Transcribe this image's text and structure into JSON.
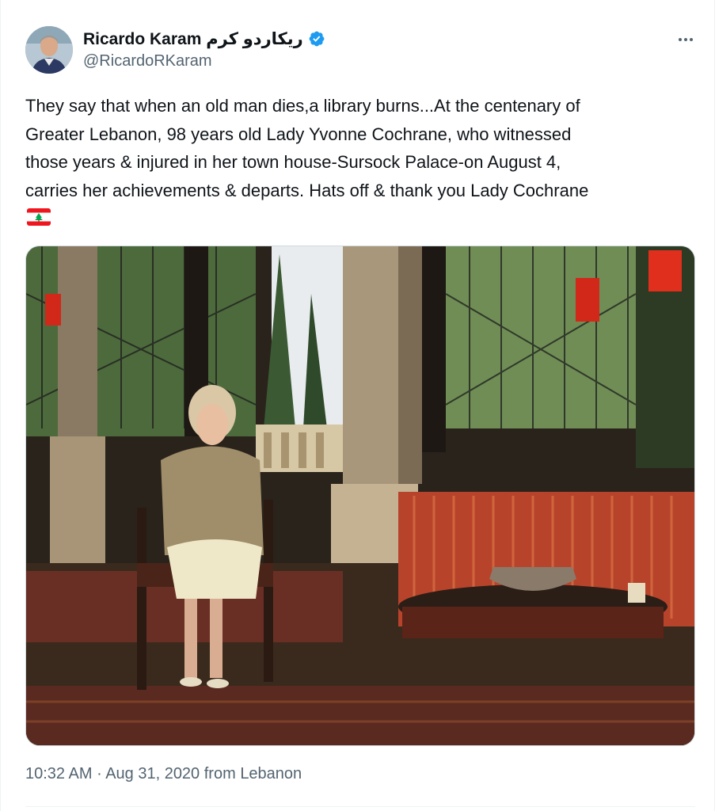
{
  "author": {
    "display_name": "Ricardo Karam ريكاردو كرم",
    "handle": "@RicardoRKaram",
    "verified_icon": "verified-badge-icon",
    "avatar_icon": "avatar-photo"
  },
  "tweet": {
    "text": "They say that when an old man dies,a library burns...At the centenary of\nGreater Lebanon, 98 years old Lady Yvonne Cochrane, who witnessed\nthose years & injured in her town house-Sursock Palace-on August 4,\ncarries her achievements & departs. Hats off & thank you Lady Cochrane",
    "emoji_icon": "lebanon-flag-icon",
    "media_icon": "photo-lady-cochrane-palace"
  },
  "meta": {
    "time": "10:32 AM",
    "separator": " · ",
    "date": "Aug 31, 2020",
    "from_label": " from ",
    "location": "Lebanon"
  },
  "colors": {
    "verified_blue": "#1d9bf0",
    "text_primary": "#0f1419",
    "text_secondary": "#536471",
    "flag_red": "#ee161f",
    "flag_green": "#00a651"
  },
  "more_icon": "more-options-icon"
}
